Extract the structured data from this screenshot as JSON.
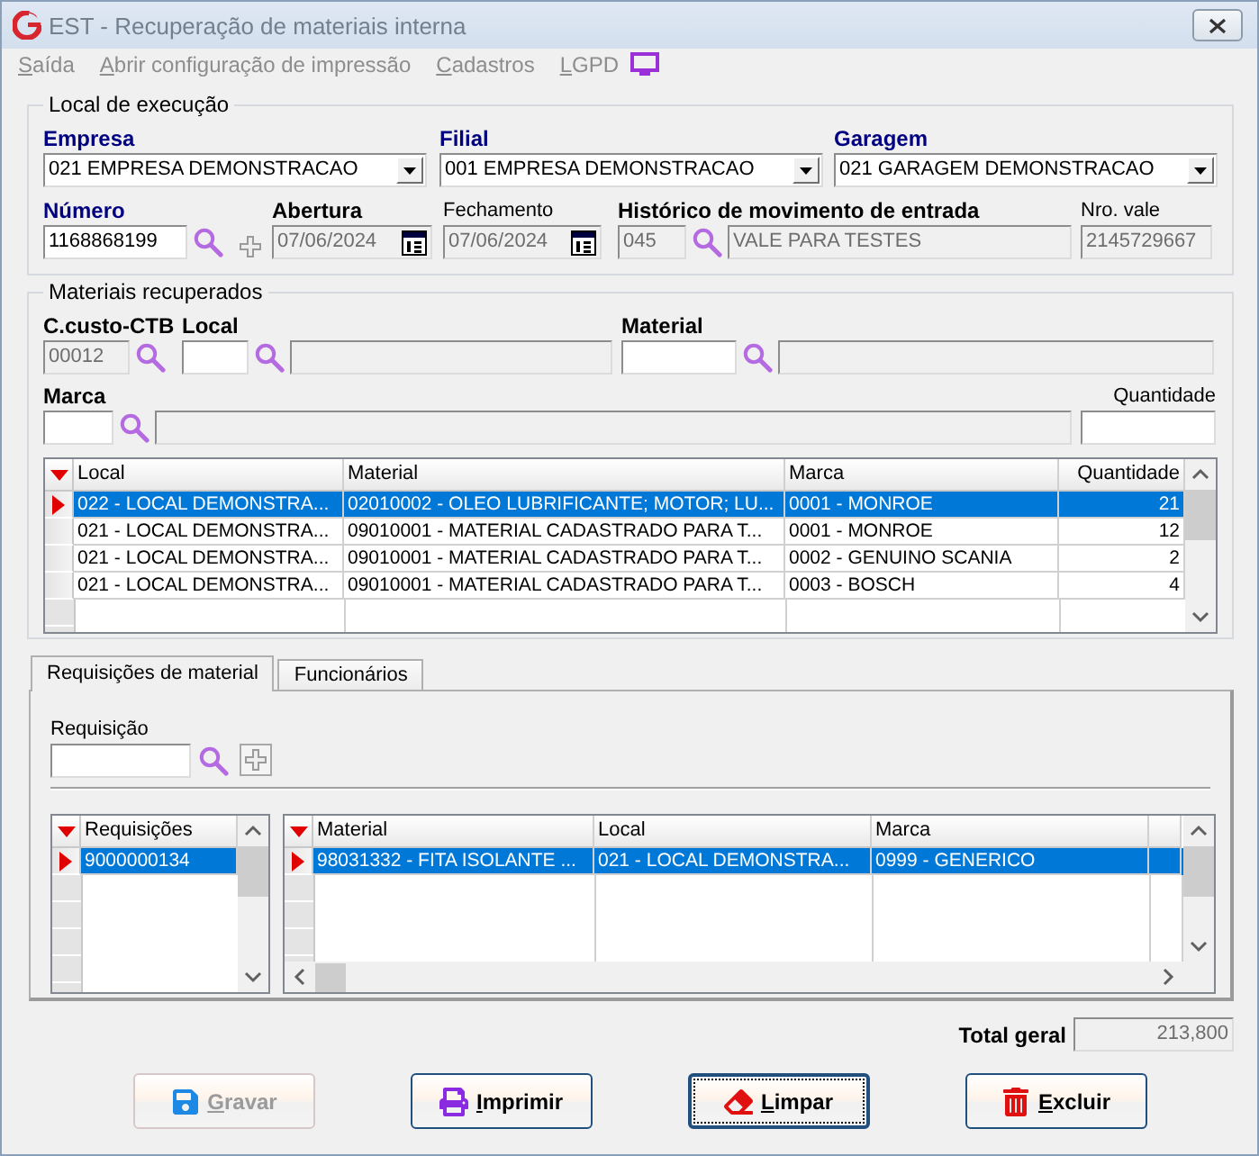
{
  "window": {
    "title": "EST - Recuperação de materiais interna"
  },
  "menu": [
    {
      "label": "Saída",
      "disabled": true
    },
    {
      "label": "Abrir configuração de impressão",
      "disabled": true
    },
    {
      "label": "Cadastros",
      "disabled": true
    },
    {
      "label": "LGPD",
      "disabled": true
    }
  ],
  "execucao": {
    "title": "Local de execução",
    "empresa": {
      "label": "Empresa",
      "kind": "required",
      "value": "021 EMPRESA DEMONSTRACAO"
    },
    "filial": {
      "label": "Filial",
      "kind": "required",
      "value": "001 EMPRESA DEMONSTRACAO"
    },
    "garagem": {
      "label": "Garagem",
      "kind": "required",
      "value": "021 GARAGEM DEMONSTRACAO"
    },
    "numero": {
      "label": "Número",
      "kind": "required",
      "value": "1168868199",
      "disabled": false
    },
    "abertura": {
      "label": "Abertura",
      "kind": "bold",
      "value": "07/06/2024",
      "disabled": true
    },
    "fechamento": {
      "label": "Fechamento",
      "kind": "plain",
      "value": "07/06/2024",
      "disabled": true
    },
    "historico": {
      "label": "Histórico de movimento de entrada",
      "kind": "bold",
      "code": "045",
      "description": "VALE PARA TESTES",
      "disabled": true
    },
    "nro_vale": {
      "label": "Nro. vale",
      "kind": "plain",
      "value": "2145729667",
      "disabled": true
    }
  },
  "materiais": {
    "title": "Materiais recuperados",
    "ccusto": {
      "label": "C.custo-CTB",
      "kind": "bold",
      "value": "00012",
      "disabled": true
    },
    "local": {
      "label": "Local",
      "kind": "bold",
      "disabled": false
    },
    "material": {
      "label": "Material",
      "kind": "bold",
      "disabled": false
    },
    "marca": {
      "label": "Marca",
      "kind": "bold",
      "disabled": false
    },
    "quantidade": {
      "label": "Quantidade",
      "kind": "plain",
      "disabled": false
    },
    "table": {
      "columns": [
        {
          "label": "Local",
          "numeric": false
        },
        {
          "label": "Material",
          "numeric": false
        },
        {
          "label": "Marca",
          "numeric": false
        },
        {
          "label": "Quantidade",
          "numeric": true
        }
      ],
      "rows": [
        {
          "cells": [
            "022 - LOCAL DEMONSTRA...",
            "02010002 - OLEO LUBRIFICANTE; MOTOR; LU...",
            "0001 - MONROE",
            "21"
          ],
          "selected": true
        },
        {
          "cells": [
            "021 - LOCAL DEMONSTRA...",
            "09010001 - MATERIAL CADASTRADO PARA T...",
            "0001 - MONROE",
            "12"
          ],
          "selected": false
        },
        {
          "cells": [
            "021 - LOCAL DEMONSTRA...",
            "09010001 - MATERIAL CADASTRADO PARA T...",
            "0002 - GENUINO SCANIA",
            "2"
          ],
          "selected": false
        },
        {
          "cells": [
            "021 - LOCAL DEMONSTRA...",
            "09010001 - MATERIAL CADASTRADO PARA T...",
            "0003 - BOSCH",
            "4"
          ],
          "selected": false
        }
      ]
    }
  },
  "tabs": [
    {
      "label": "Requisições de material",
      "selected": true
    },
    {
      "label": "Funcionários",
      "selected": false
    }
  ],
  "requisicao": {
    "label": "Requisição",
    "kind": "plain",
    "disabled": false
  },
  "requisicoes_table": {
    "columns": [
      {
        "label": "Requisições",
        "numeric": false
      }
    ],
    "rows": [
      {
        "cells": [
          "9000000134"
        ],
        "selected": true
      }
    ]
  },
  "itens_table": {
    "columns": [
      {
        "label": "Material",
        "numeric": false
      },
      {
        "label": "Local",
        "numeric": false
      },
      {
        "label": "Marca",
        "numeric": false
      }
    ],
    "rows": [
      {
        "cells": [
          "98031332 - FITA ISOLANTE ...",
          "021 - LOCAL DEMONSTRA...",
          "0999 - GENERICO"
        ],
        "selected": true
      }
    ]
  },
  "total": {
    "label": "Total geral",
    "value": "213,800"
  },
  "buttons": [
    {
      "label": "Gravar",
      "kind": "save",
      "disabled": true,
      "focused": false
    },
    {
      "label": "Imprimir",
      "kind": "print",
      "disabled": false,
      "focused": false
    },
    {
      "label": "Limpar",
      "kind": "clear",
      "disabled": false,
      "focused": true
    },
    {
      "label": "Excluir",
      "kind": "delete",
      "disabled": false,
      "focused": false
    }
  ]
}
